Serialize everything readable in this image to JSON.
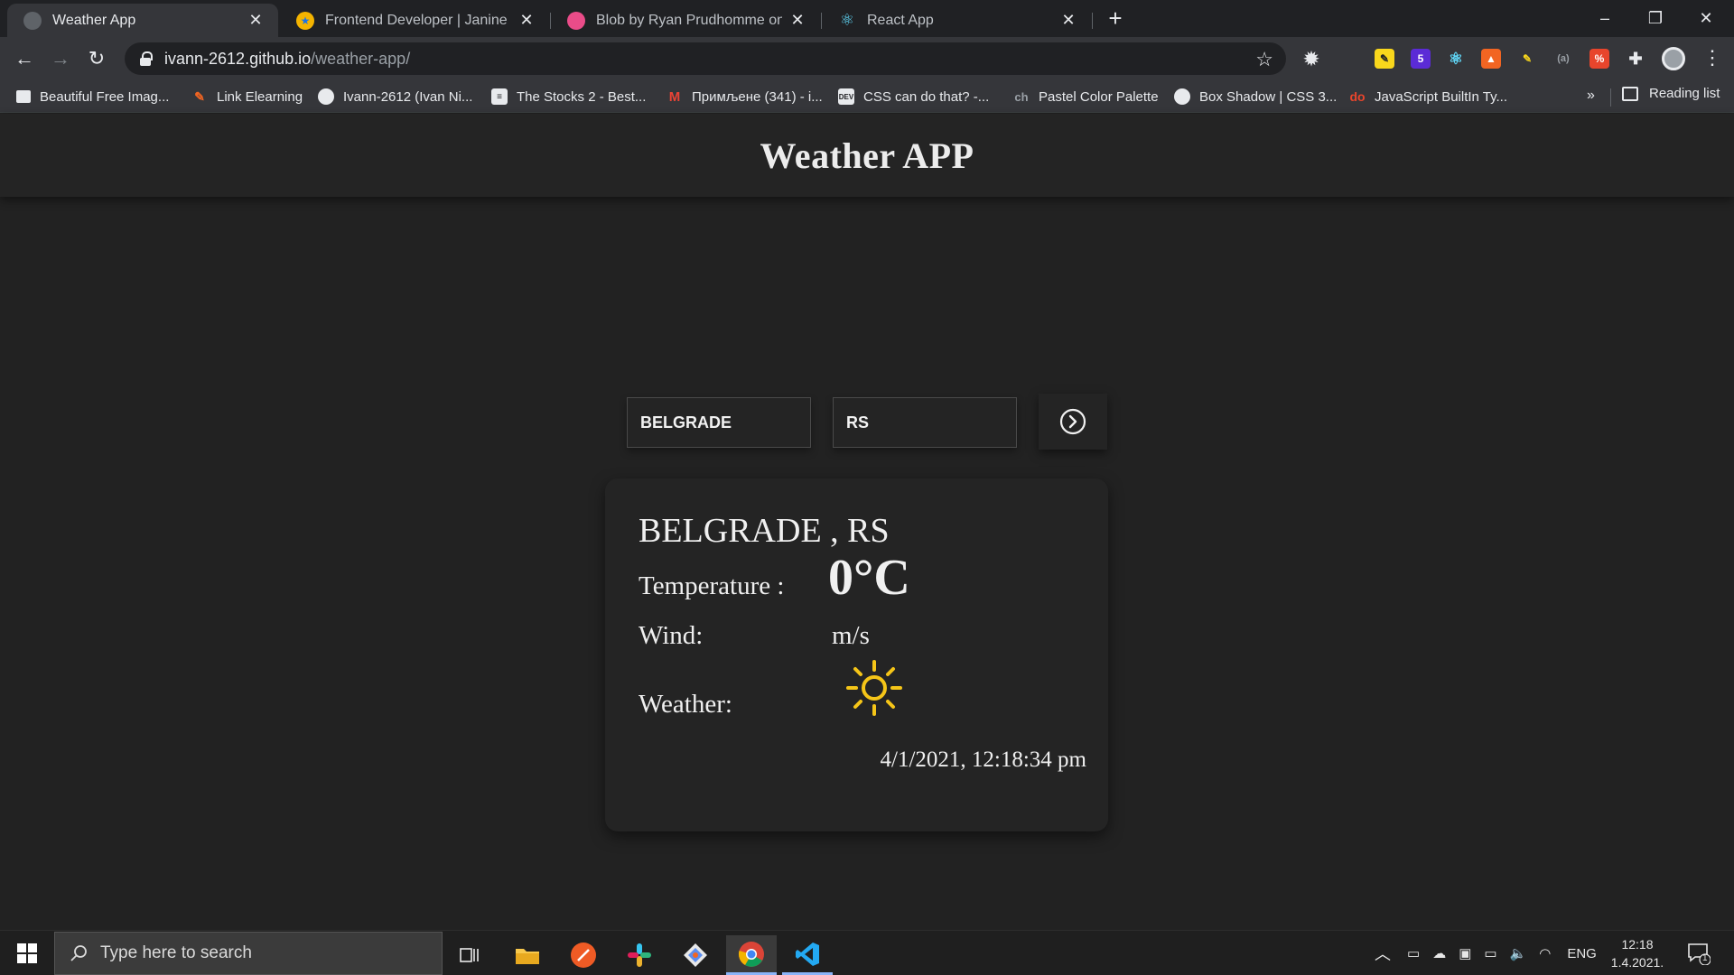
{
  "browser": {
    "tabs": [
      {
        "title": "Weather App",
        "active": true
      },
      {
        "title": "Frontend Developer | Janine Mar",
        "active": false
      },
      {
        "title": "Blob by Ryan Prudhomme on Dri",
        "active": false
      },
      {
        "title": "React App",
        "active": false
      }
    ],
    "address": {
      "host": "ivann-2612.github.io",
      "path": "/weather-app/"
    },
    "bookmarks": [
      "Beautiful Free Imag...",
      "Link Elearning",
      "Ivann-2612 (Ivan Ni...",
      "The Stocks 2 - Best...",
      "Примљене (341) - i...",
      "CSS can do that? -...",
      "Pastel Color Palette",
      "Box Shadow | CSS 3...",
      "JavaScript BuiltIn Ty..."
    ],
    "bookmarks_overflow": "»",
    "reading_list": "Reading list"
  },
  "app": {
    "title": "Weather APP",
    "city_value": "BELGRADE",
    "country_value": "RS",
    "card": {
      "location": "BELGRADE , RS",
      "temperature_label": "Temperature :",
      "temperature_value": "0°C",
      "wind_label": "Wind:",
      "wind_value": "m/s",
      "weather_label": "Weather:",
      "weather_icon": "sun-icon",
      "timestamp": "4/1/2021, 12:18:34 pm"
    }
  },
  "taskbar": {
    "search_placeholder": "Type here to search",
    "language": "ENG",
    "time": "12:18",
    "date": "1.4.2021.",
    "notification_count": "1"
  },
  "colors": {
    "page_bg": "#222222",
    "card_bg": "#242424",
    "sun": "#f5c518"
  }
}
